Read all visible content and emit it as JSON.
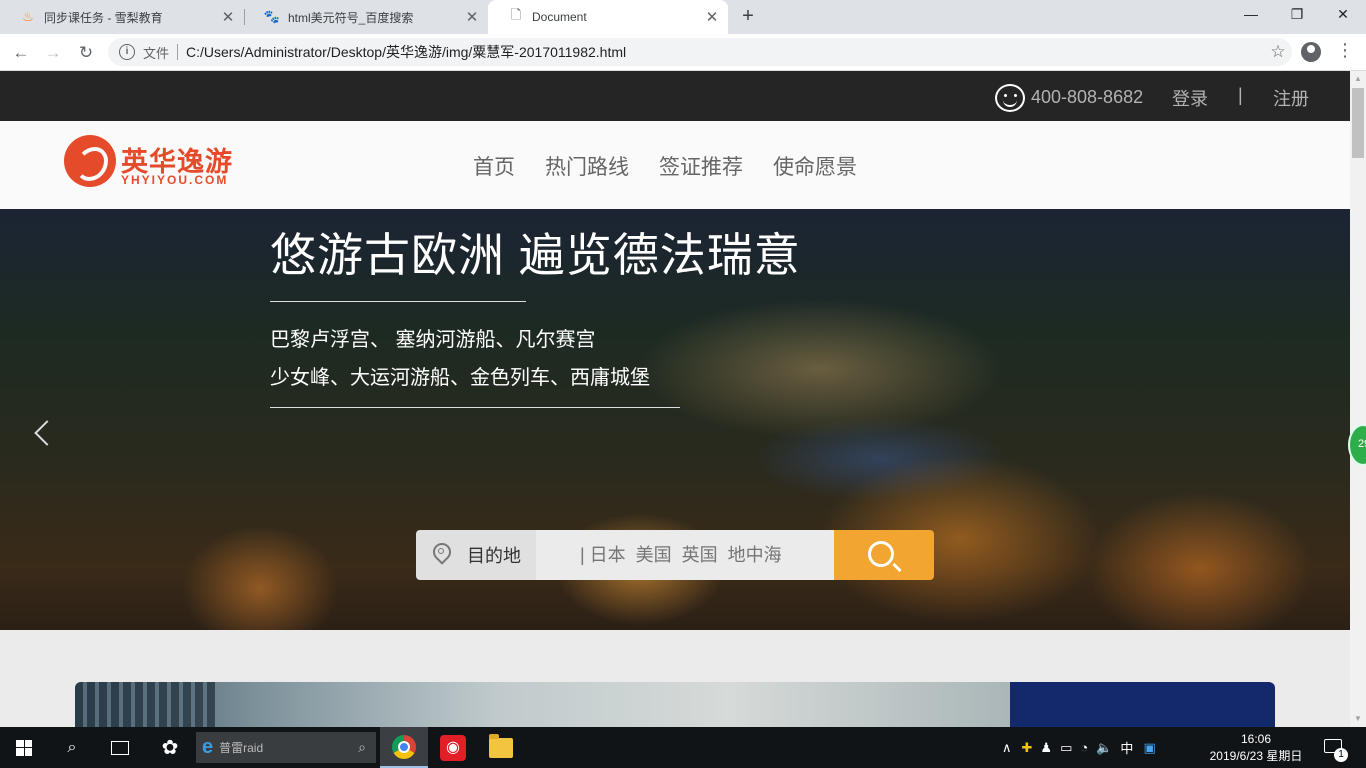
{
  "browser": {
    "tabs": [
      {
        "title": "同步课任务 - 雪梨教育",
        "icon": "flame-icon"
      },
      {
        "title": "html美元符号_百度搜索",
        "icon": "baidu-paw-icon"
      },
      {
        "title": "Document",
        "icon": "document-icon"
      }
    ],
    "active_tab": 2,
    "address": {
      "scheme_label": "文件",
      "url": "C:/Users/Administrator/Desktop/英华逸游/img/粟慧军-2017011982.html"
    }
  },
  "site": {
    "topbar": {
      "phone": "400-808-8682",
      "login": "登录",
      "separator": "|",
      "register": "注册"
    },
    "logo": {
      "cn": "英华逸游",
      "en": "YHYIYOU.COM"
    },
    "nav": [
      "首页",
      "热门路线",
      "签证推荐",
      "使命愿景"
    ],
    "hero": {
      "title": "悠游古欧洲 遍览德法瑞意",
      "line1": "巴黎卢浮宫、 塞纳河游船、凡尔赛宫",
      "line2": "少女峰、大运河游船、金色列车、西庸城堡"
    },
    "search": {
      "label": "目的地",
      "placeholder": "| 日本  美国  英国  地中海"
    }
  },
  "float_badge": "29",
  "taskbar": {
    "search_text": "普雷raid",
    "ime": "中",
    "time": "16:06",
    "date": "2019/6/23 星期日",
    "notifications": "1"
  },
  "colors": {
    "brand": "#e54b2a",
    "search_button": "#f2a530",
    "topbar_bg": "#252525",
    "card_panel": "#13296b"
  }
}
